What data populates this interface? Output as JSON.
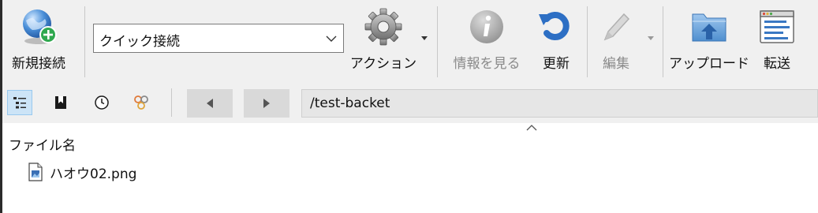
{
  "toolbar": {
    "new_connection_label": "新規接続",
    "quick_connect_value": "クイック接続",
    "action_label": "アクション",
    "info_label": "情報を見る",
    "refresh_label": "更新",
    "edit_label": "編集",
    "upload_label": "アップロード",
    "transfer_label": "転送"
  },
  "nav": {
    "path": "/test-backet"
  },
  "browser": {
    "column_filename": "ファイル名",
    "files": [
      "ハオウ02.png"
    ]
  },
  "colors": {
    "accent": "#3a78c3",
    "toolbar_bg": "#f0f0f0",
    "disabled_text": "#8a8a8a"
  }
}
